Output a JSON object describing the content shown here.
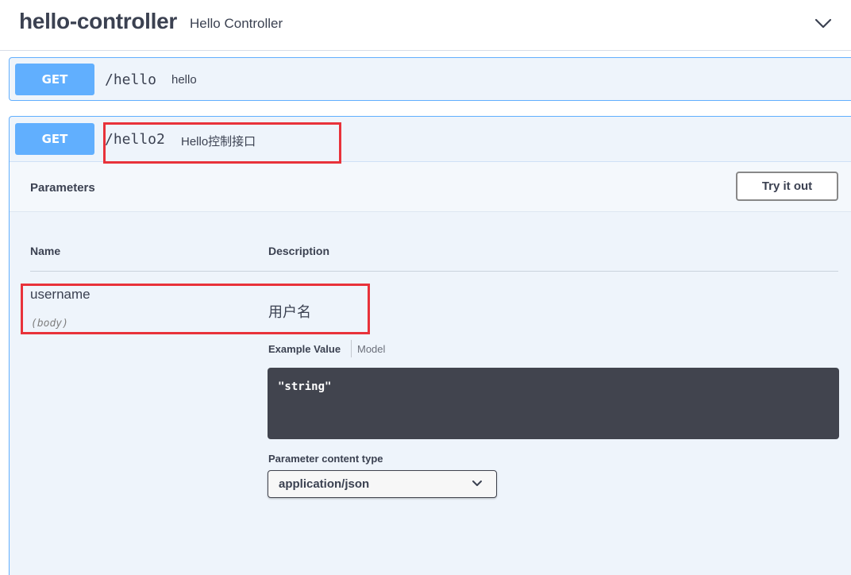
{
  "tag": {
    "name": "hello-controller",
    "description": "Hello Controller",
    "toggle_icon": "chevron-down-icon"
  },
  "operations": [
    {
      "method": "GET",
      "path": "/hello",
      "summary": "hello"
    },
    {
      "method": "GET",
      "path": "/hello2",
      "summary": "Hello控制接口"
    }
  ],
  "parameters_section": {
    "title": "Parameters",
    "try_button": "Try it out",
    "columns": {
      "name": "Name",
      "description": "Description"
    },
    "params": [
      {
        "name": "username",
        "in": "(body)",
        "description": "用户名"
      }
    ],
    "example_tab": "Example Value",
    "model_tab": "Model",
    "example_code": "\"string\"",
    "content_type_label": "Parameter content type",
    "content_type_value": "application/json"
  },
  "colors": {
    "get_method": "#61affe",
    "opblock_bg": "#eef4fb",
    "highlight_box": "#e8323a",
    "code_bg": "#41444e"
  }
}
